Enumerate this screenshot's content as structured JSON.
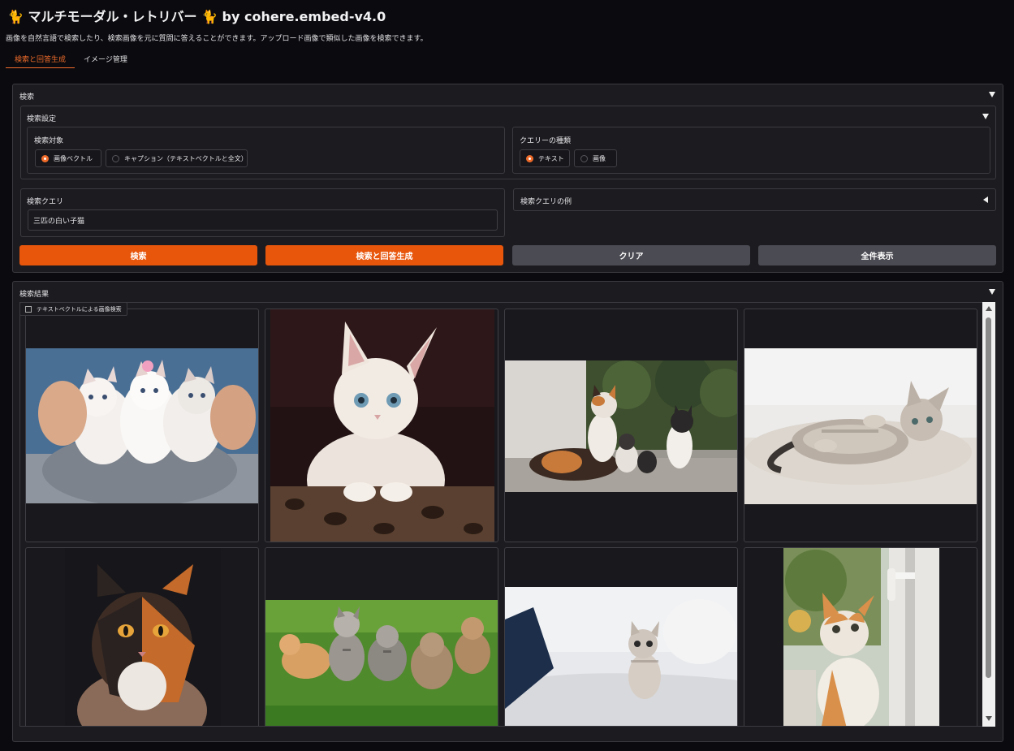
{
  "header": {
    "title": "🐈 マルチモーダル・レトリバー 🐈 by cohere.embed-v4.0",
    "description": "画像を自然言語で検索したり、検索画像を元に質問に答えることができます。アップロード画像で類似した画像を検索できます。"
  },
  "tabs": [
    {
      "label": "検索と回答生成",
      "active": true
    },
    {
      "label": "イメージ管理",
      "active": false
    }
  ],
  "search_panel": {
    "title": "検索",
    "settings": {
      "title": "検索設定",
      "target": {
        "label": "検索対象",
        "options": [
          {
            "label": "画像ベクトル",
            "selected": true
          },
          {
            "label": "キャプション（テキストベクトルと全文）",
            "selected": false
          }
        ]
      },
      "query_type": {
        "label": "クエリーの種類",
        "options": [
          {
            "label": "テキスト",
            "selected": true
          },
          {
            "label": "画像",
            "selected": false
          }
        ]
      }
    },
    "query": {
      "label": "検索クエリ",
      "value": "三匹の白い子猫"
    },
    "examples": {
      "label": "検索クエリの例"
    },
    "buttons": {
      "search": "検索",
      "search_and_answer": "検索と回答生成",
      "clear": "クリア",
      "show_all": "全件表示"
    }
  },
  "results_panel": {
    "title": "検索結果",
    "gallery_label": "テキストベクトルによる画像検索",
    "image_count": 8
  },
  "colors": {
    "accent": "#e8560c",
    "secondary_button": "#4b4b53",
    "background": "#0b0b0f",
    "panel": "#1c1c20"
  },
  "icons": {
    "collapse": "triangle-down-icon",
    "expand": "triangle-left-icon",
    "gallery": "image-icon"
  }
}
